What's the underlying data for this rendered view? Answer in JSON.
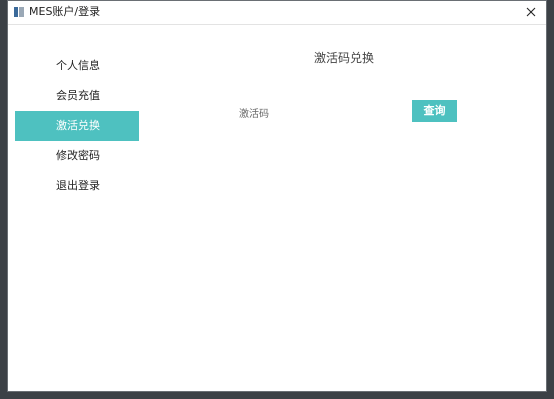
{
  "window": {
    "title": "MES账户/登录"
  },
  "sidebar": {
    "items": [
      {
        "label": "个人信息",
        "active": false
      },
      {
        "label": "会员充值",
        "active": false
      },
      {
        "label": "激活兑换",
        "active": true
      },
      {
        "label": "修改密码",
        "active": false
      },
      {
        "label": "退出登录",
        "active": false
      }
    ]
  },
  "main": {
    "title": "激活码兑换",
    "code_label": "激活码",
    "code_value": "",
    "query_label": "查询"
  },
  "colors": {
    "accent": "#4ec1c0",
    "window_bg": "#ffffff",
    "desktop_bg": "#3c4146"
  },
  "icons": {
    "app": "app-icon",
    "close": "close-icon"
  }
}
